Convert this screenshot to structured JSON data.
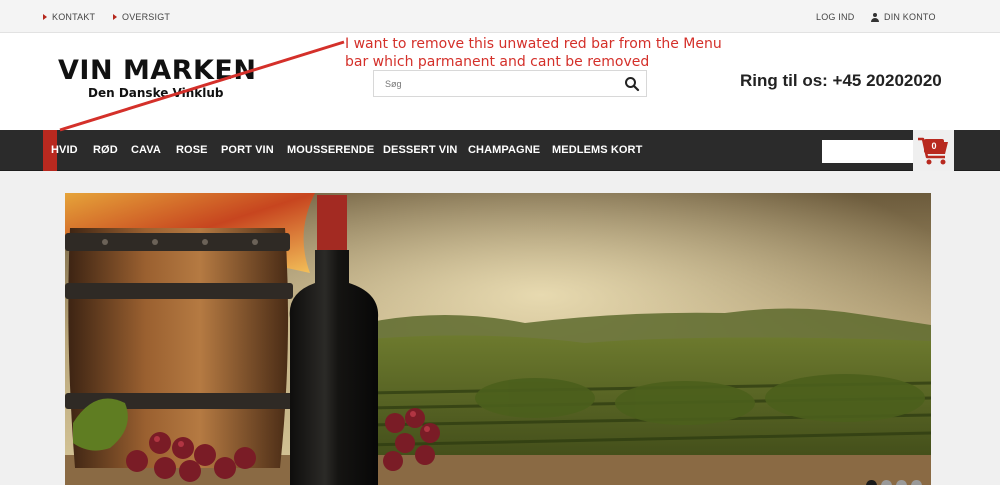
{
  "topbar": {
    "left_links": [
      "KONTAKT",
      "OVERSIGT"
    ],
    "login": "LOG IND",
    "account": "DIN KONTO"
  },
  "header": {
    "logo_main": "VIN MARKEN",
    "logo_sub": "Den Danske Vinklub",
    "search_placeholder": "Søg",
    "phone": "Ring til os: +45 20202020"
  },
  "annotation": {
    "line1": "I want to remove this unwated  red bar from the Menu",
    "line2": "bar which parmanent and cant be removed"
  },
  "nav": {
    "items": [
      "HVID",
      "RØD",
      "CAVA",
      "ROSE",
      "PORT VIN",
      "MOUSSERENDE",
      "DESSERT VIN",
      "CHAMPAGNE",
      "MEDLEMS KORT"
    ],
    "cart_count": "0"
  },
  "colors": {
    "accent": "#b8291f",
    "nav_bg": "#2b2b2b",
    "annotation": "#d4302a"
  },
  "hero": {
    "slide_count": 4,
    "active_slide": 1
  }
}
